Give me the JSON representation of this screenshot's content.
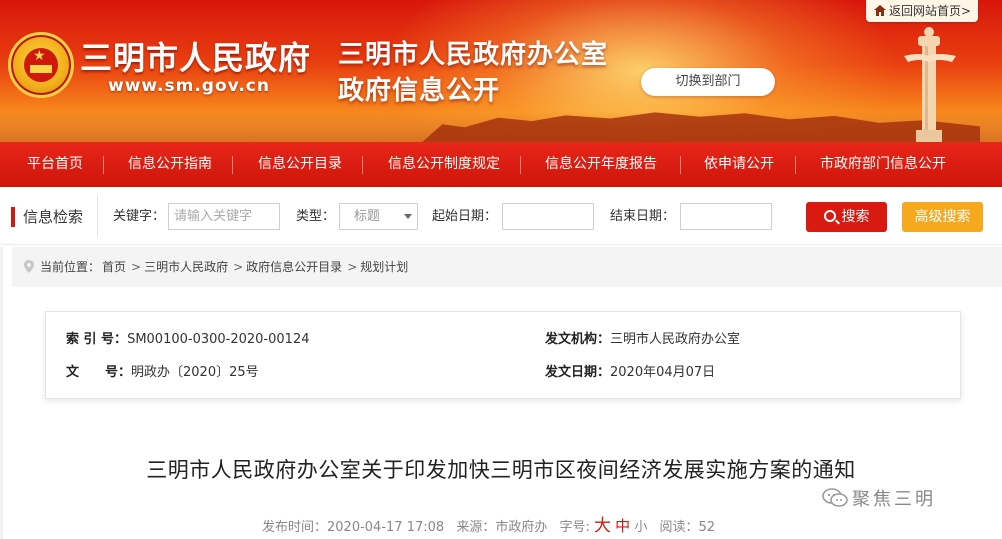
{
  "header": {
    "site_title": "三明市人民政府",
    "site_url": "www.sm.gov.cn",
    "banner_title_1": "三明市人民政府办公室",
    "banner_title_2": "政府信息公开",
    "return_link": "返回网站首页>",
    "switch_button": "切换到部门"
  },
  "nav": {
    "items": [
      {
        "label": "平台首页"
      },
      {
        "label": "信息公开指南"
      },
      {
        "label": "信息公开目录"
      },
      {
        "label": "信息公开制度规定"
      },
      {
        "label": "信息公开年度报告"
      },
      {
        "label": "依申请公开"
      },
      {
        "label": "市政府部门信息公开"
      }
    ]
  },
  "search": {
    "section_label": "信息检索",
    "keyword_label": "关键字：",
    "keyword_placeholder": "请输入关键字",
    "type_label": "类型：",
    "type_value": "标题",
    "start_label": "起始日期：",
    "end_label": "结束日期：",
    "search_button": "搜索",
    "advanced_button": "高级搜索"
  },
  "breadcrumb": {
    "prefix": "当前位置：",
    "items": [
      "首页",
      "三明市人民政府",
      "政府信息公开目录",
      "规划计划"
    ]
  },
  "info": {
    "index_label": "索 引 号：",
    "index_value": "SM00100-0300-2020-00124",
    "issuer_label": "发文机构：",
    "issuer_value": "三明市人民政府办公室",
    "docno_label": "文　　号：",
    "docno_value": "明政办〔2020〕25号",
    "date_label": "发文日期：",
    "date_value": "2020年04月07日"
  },
  "article": {
    "title": "三明市人民政府办公室关于印发加快三明市区夜间经济发展实施方案的通知",
    "wechat_watermark": "聚焦三明",
    "publish_label": "发布时间：",
    "publish_value": "2020-04-17 17:08",
    "source_label": "来源：",
    "source_value": "市政府办",
    "font_label": "字号:",
    "font_large": "大",
    "font_medium": "中",
    "font_small": "小",
    "read_label": "阅读：",
    "read_value": "52"
  },
  "colors": {
    "brand_red": "#d81a11",
    "accent_orange": "#f6a81e"
  }
}
